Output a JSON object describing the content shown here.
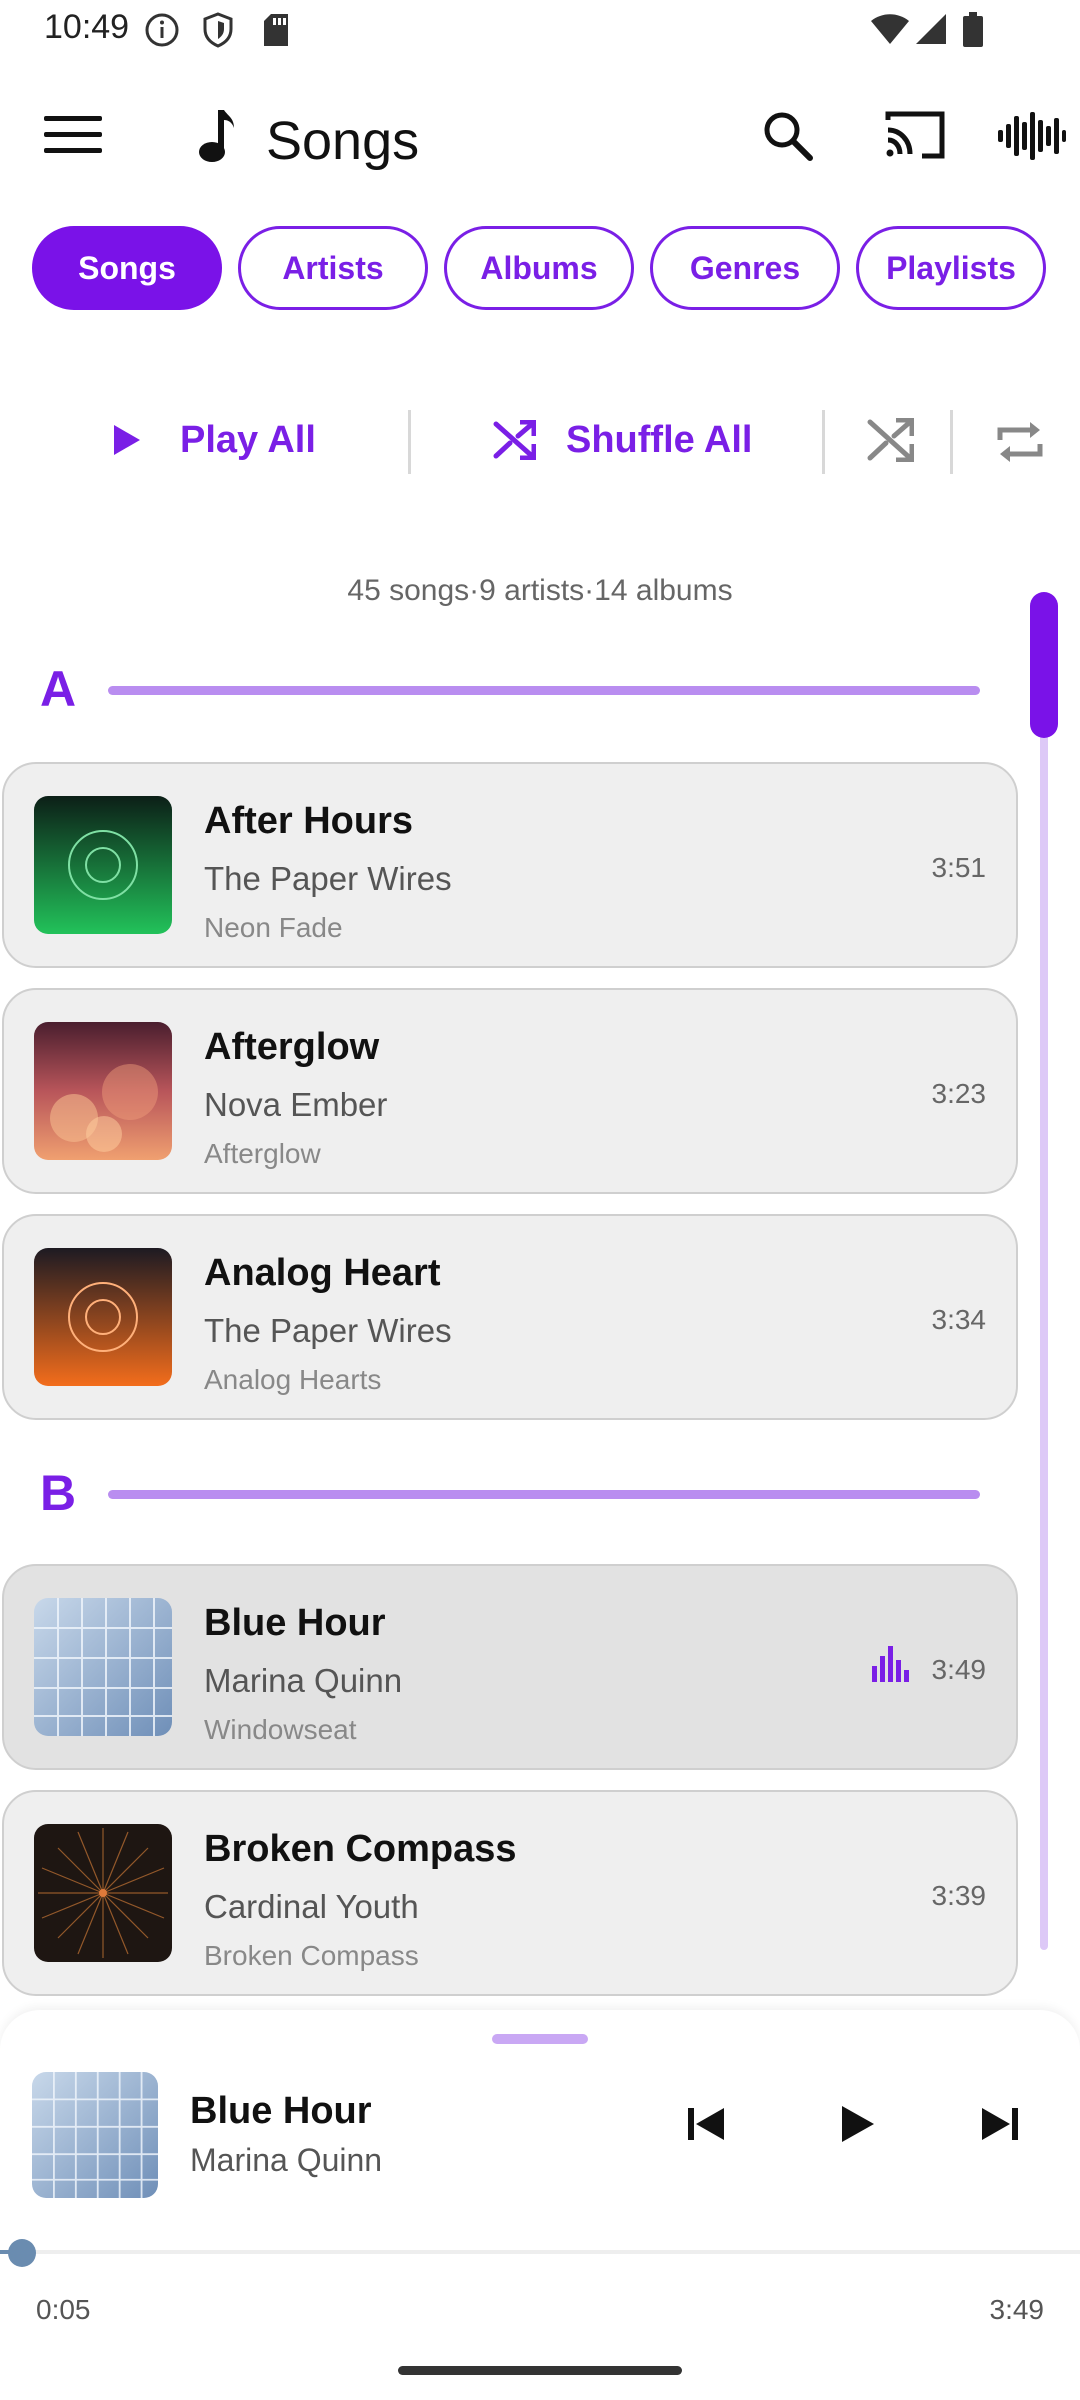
{
  "status_bar": {
    "time": "10:49",
    "icons": [
      "info-icon",
      "shield-icon",
      "sd-card-icon",
      "wifi-icon",
      "signal-icon",
      "battery-icon"
    ]
  },
  "app_bar": {
    "title": "Songs",
    "icons": [
      "menu-icon",
      "music-note-icon",
      "search-icon",
      "cast-icon",
      "waveform-icon"
    ]
  },
  "tabs": [
    {
      "label": "Songs",
      "active": true
    },
    {
      "label": "Artists",
      "active": false
    },
    {
      "label": "Albums",
      "active": false
    },
    {
      "label": "Genres",
      "active": false
    },
    {
      "label": "Playlists",
      "active": false
    }
  ],
  "actions": {
    "play_all": "Play All",
    "shuffle_all": "Shuffle All"
  },
  "summary": "45 songs·9 artists·14 albums",
  "sections": [
    {
      "letter": "A",
      "songs": [
        {
          "title": "After Hours",
          "artist": "The Paper Wires",
          "album": "Neon Fade",
          "duration": "3:51"
        },
        {
          "title": "Afterglow",
          "artist": "Nova Ember",
          "album": "Afterglow",
          "duration": "3:23"
        },
        {
          "title": "Analog Heart",
          "artist": "The Paper Wires",
          "album": "Analog Hearts",
          "duration": "3:34"
        }
      ]
    },
    {
      "letter": "B",
      "songs": [
        {
          "title": "Blue Hour",
          "artist": "Marina Quinn",
          "album": "Windowseat",
          "duration": "3:49",
          "now_playing": true
        },
        {
          "title": "Broken Compass",
          "artist": "Cardinal Youth",
          "album": "Broken Compass",
          "duration": "3:39"
        }
      ]
    }
  ],
  "now_playing": {
    "title": "Blue Hour",
    "artist": "Marina Quinn",
    "elapsed": "0:05",
    "total": "3:49",
    "progress_fraction": 0.022
  },
  "colors": {
    "accent": "#7a12e8",
    "card_bg": "#efefef",
    "section_line": "#b98df0"
  }
}
